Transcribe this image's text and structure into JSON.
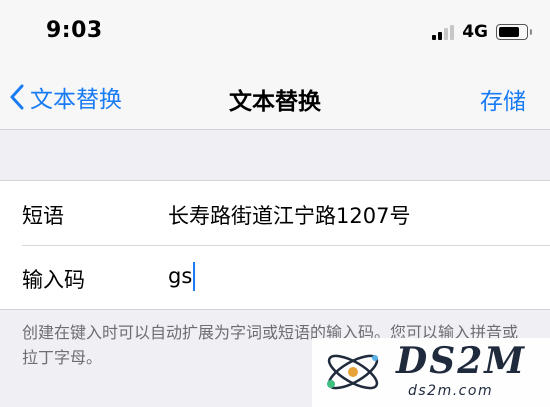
{
  "status_bar": {
    "time": "9:03",
    "network": "4G",
    "signal_bars": 4,
    "signal_bars_active": 2,
    "battery_level": 0.8
  },
  "nav": {
    "back_label": "文本替换",
    "title": "文本替换",
    "save_label": "存储"
  },
  "form": {
    "rows": [
      {
        "label": "短语",
        "value": "长寿路街道江宁路1207号"
      },
      {
        "label": "输入码",
        "value": "gs"
      }
    ]
  },
  "footer": {
    "hint": "创建在键入时可以自动扩展为字词或短语的输入码。您可以输入拼音或拉丁字母。"
  },
  "watermark": {
    "title": "DS2M",
    "subtitle": "ds2m.com"
  },
  "colors": {
    "accent": "#1a7cf5",
    "background": "#efeff4",
    "secondary_text": "#6d6d72"
  }
}
